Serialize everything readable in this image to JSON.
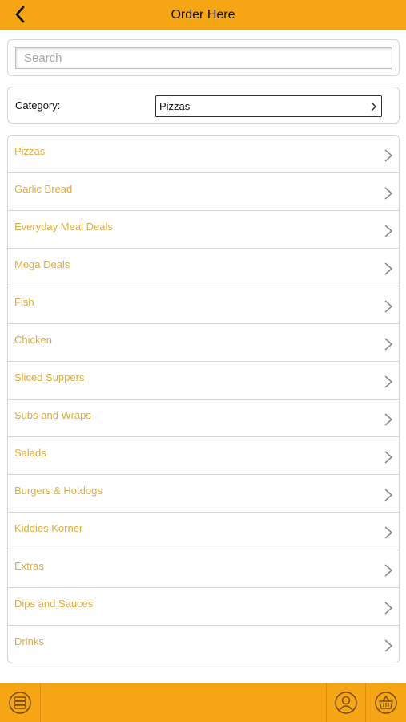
{
  "header": {
    "title": "Order Here",
    "back_icon": "chevron-left-icon"
  },
  "search": {
    "placeholder": "Search",
    "value": ""
  },
  "category": {
    "label": "Category:",
    "selected": "Pizzas"
  },
  "menu": {
    "items": [
      {
        "label": "Pizzas"
      },
      {
        "label": "Garlic Bread"
      },
      {
        "label": "Everyday Meal Deals"
      },
      {
        "label": "Mega Deals"
      },
      {
        "label": "Fish"
      },
      {
        "label": "Chicken"
      },
      {
        "label": "Sliced Suppers"
      },
      {
        "label": "Subs and Wraps"
      },
      {
        "label": "Salads"
      },
      {
        "label": "Burgers & Hotdogs"
      },
      {
        "label": "Kiddies Korner"
      },
      {
        "label": "Extras"
      },
      {
        "label": "Dips and Sauces"
      },
      {
        "label": "Drinks"
      }
    ]
  },
  "footer": {
    "icons": [
      "menu-stack-icon",
      "account-icon",
      "basket-icon"
    ]
  },
  "colors": {
    "accent": "#f6a514",
    "item_text": "#e0ac3a",
    "chevron": "#8a8a8a"
  }
}
